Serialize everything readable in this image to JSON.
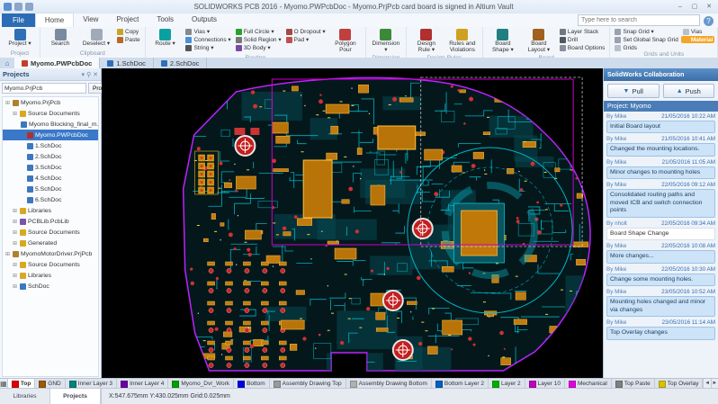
{
  "window": {
    "title": "SOLIDWORKS PCB 2016 - Myomo.PWPcbDoc - Myomo.PrjPcb card board is signed in Altium Vault",
    "minimize": "–",
    "maximize": "▢",
    "close": "✕"
  },
  "menu": {
    "file_tab": "File",
    "tabs": [
      "Home",
      "View",
      "Project",
      "Tools",
      "Outputs"
    ],
    "active_tab": "Home",
    "search_placeholder": "Type here to search",
    "help_icon": "?"
  },
  "ribbon": {
    "groups": [
      {
        "label": "Project",
        "items": [
          {
            "label": "Project",
            "big": true,
            "dd": true,
            "color": "#2f6fb8"
          }
        ]
      },
      {
        "label": "Clipboard",
        "items": [
          {
            "label": "Search",
            "big": true,
            "color": "#7a8aa0"
          },
          {
            "label": "Deselect",
            "big": true,
            "dd": true,
            "color": "#a0aab8"
          },
          {
            "label": "Copy",
            "color": "#c9a227"
          },
          {
            "label": "Paste",
            "color": "#b56a2a"
          }
        ]
      },
      {
        "label": "Routing",
        "items": [
          {
            "label": "Route",
            "big": true,
            "dd": true,
            "color": "#0aa0a0"
          },
          {
            "label": "Vias",
            "dd": true,
            "color": "#888888"
          },
          {
            "label": "Connections",
            "dd": true,
            "color": "#4a90d9"
          },
          {
            "label": "String",
            "dd": true,
            "color": "#555555"
          },
          {
            "label": "Full Circle",
            "dd": true,
            "color": "#2aa02a"
          },
          {
            "label": "Solid Region",
            "dd": true,
            "color": "#777777"
          },
          {
            "label": "3D Body",
            "dd": true,
            "color": "#7a4aa0"
          },
          {
            "label": "O Dropout",
            "dd": true,
            "color": "#a04a4a"
          },
          {
            "label": "Pad",
            "dd": true,
            "color": "#c05050"
          },
          {
            "label": "Polygon Pour",
            "big": true,
            "color": "#c04040"
          }
        ]
      },
      {
        "label": "Dimension",
        "items": [
          {
            "label": "Dimension",
            "big": true,
            "dd": true,
            "color": "#3a8a3a"
          }
        ]
      },
      {
        "label": "Design Rules",
        "items": [
          {
            "label": "Design Rule",
            "big": true,
            "dd": true,
            "color": "#b03030"
          },
          {
            "label": "Rules and Violations",
            "big": true,
            "color": "#d0a020"
          }
        ]
      },
      {
        "label": "Board",
        "items": [
          {
            "label": "Board Shape",
            "big": true,
            "dd": true,
            "color": "#208080"
          },
          {
            "label": "Board Layout",
            "big": true,
            "dd": true,
            "color": "#a06020"
          },
          {
            "label": "Layer Stack",
            "color": "#707880"
          },
          {
            "label": "Drill",
            "color": "#505860"
          },
          {
            "label": "Board Options",
            "color": "#8890a0"
          }
        ]
      },
      {
        "label": "Grids and Units",
        "items": [
          {
            "label": "Snap Grid",
            "dd": true,
            "color": "#9aa2b0"
          },
          {
            "label": "Set Global Snap Grid",
            "color": "#9aa2b0"
          },
          {
            "label": "Grids",
            "color": "#b8c0cc"
          },
          {
            "label": "Vias",
            "color": "#b8c0cc"
          },
          {
            "label": "Material",
            "accent": true,
            "color": "#f5a623"
          }
        ]
      }
    ]
  },
  "document_tabs": {
    "home_icon": "⌂",
    "tabs": [
      {
        "label": "Myomo.PWPcbDoc",
        "active": true,
        "color": "#c43c2a"
      },
      {
        "label": "1.SchDoc",
        "active": false,
        "color": "#2f6fb8"
      },
      {
        "label": "2.SchDoc",
        "active": false,
        "color": "#2f6fb8"
      }
    ]
  },
  "projects_panel": {
    "title": "Projects",
    "header_icons": [
      "▾",
      "✕"
    ],
    "selector_value": "Myomo.PrjPcb",
    "project_button": "Project",
    "tree": [
      {
        "depth": 0,
        "label": "Myomo.PrjPcb",
        "type": "project"
      },
      {
        "depth": 1,
        "label": "Source Documents",
        "type": "folder"
      },
      {
        "depth": 2,
        "label": "Myomo Blocking_final_m...",
        "type": "sch"
      },
      {
        "depth": 2,
        "label": "Myomo.PWPcbDoc",
        "type": "pcb",
        "selected": true
      },
      {
        "depth": 2,
        "label": "1.SchDoc",
        "type": "sch"
      },
      {
        "depth": 2,
        "label": "2.SchDoc",
        "type": "sch"
      },
      {
        "depth": 2,
        "label": "3.SchDoc",
        "type": "sch"
      },
      {
        "depth": 2,
        "label": "4.SchDoc",
        "type": "sch"
      },
      {
        "depth": 2,
        "label": "5.SchDoc",
        "type": "sch"
      },
      {
        "depth": 2,
        "label": "6.SchDoc",
        "type": "sch"
      },
      {
        "depth": 1,
        "label": "Libraries",
        "type": "folder"
      },
      {
        "depth": 1,
        "label": "PCBLib.PcbLib",
        "type": "lib"
      },
      {
        "depth": 1,
        "label": "Source Documents",
        "type": "folder"
      },
      {
        "depth": 1,
        "label": "Generated",
        "type": "folder"
      },
      {
        "depth": 0,
        "label": "MyomoMotorDriver.PrjPcb",
        "type": "project"
      },
      {
        "depth": 1,
        "label": "Source Documents",
        "type": "folder"
      },
      {
        "depth": 1,
        "label": "Libraries",
        "type": "folder"
      },
      {
        "depth": 1,
        "label": "SchDoc",
        "type": "sch"
      }
    ],
    "bottom_tabs": [
      "Libraries",
      "Projects"
    ],
    "active_bottom_tab": "Projects"
  },
  "collaboration": {
    "title": "SolidWorks Collaboration",
    "pull_label": "Pull",
    "push_label": "Push",
    "project_row": "Project: Myomo",
    "entries": [
      {
        "by": "By Mike",
        "time": "21/05/2016 10:22 AM",
        "text": "Initial Board layout",
        "highlight": true
      },
      {
        "by": "By Mike",
        "time": "21/05/2016 10:41 AM",
        "text": "Changed the mounting locations.",
        "highlight": true
      },
      {
        "by": "By Mike",
        "time": "21/05/2016 11:05 AM",
        "text": "Minor changes to mounting holes",
        "highlight": true
      },
      {
        "by": "By Mike",
        "time": "22/05/2016 09:12 AM",
        "text": "Consolidated routing paths and moved ICB and switch connection points",
        "highlight": true
      },
      {
        "by": "By nholt",
        "time": "22/05/2016 09:34 AM",
        "text": "Board Shape Change",
        "highlight": false
      },
      {
        "by": "By Mike",
        "time": "22/05/2016 10:08 AM",
        "text": "More changes...",
        "highlight": true
      },
      {
        "by": "By Mike",
        "time": "22/05/2016 10:30 AM",
        "text": "Change some mounting holes.",
        "highlight": true
      },
      {
        "by": "By Mike",
        "time": "23/05/2016 10:52 AM",
        "text": "Mounting holes changed and minor via changes",
        "highlight": true
      },
      {
        "by": "By Mike",
        "time": "23/05/2016 11:14 AM",
        "text": "Top Overlay changes",
        "highlight": true
      }
    ]
  },
  "layer_bar": {
    "grid_icon": "▦",
    "nav_left": "◄",
    "nav_right": "►",
    "layers": [
      {
        "label": "Top",
        "color": "#e00000",
        "active": true
      },
      {
        "label": "GND",
        "color": "#9c5a00"
      },
      {
        "label": "Inner Layer 3",
        "color": "#00847a"
      },
      {
        "label": "Inner Layer 4",
        "color": "#6a00a8"
      },
      {
        "label": "Myomo_Dvr_Work",
        "color": "#00a000"
      },
      {
        "label": "Bottom",
        "color": "#0000e0"
      },
      {
        "label": "Assembly Drawing Top",
        "color": "#9a9a9a"
      },
      {
        "label": "Assembly Drawing Bottom",
        "color": "#b0b0b0"
      },
      {
        "label": "Bottom Layer 2",
        "color": "#0060c0"
      },
      {
        "label": "Layer 2",
        "color": "#00b000"
      },
      {
        "label": "Layer 10",
        "color": "#c000c0"
      },
      {
        "label": "Mechanical",
        "color": "#e000e0"
      },
      {
        "label": "Top Paste",
        "color": "#808080"
      },
      {
        "label": "Top Overlay",
        "color": "#d6c200"
      }
    ]
  },
  "status_bar": {
    "position": "X:547.675mm   Y:430.025mm   Grid:0.025mm"
  }
}
